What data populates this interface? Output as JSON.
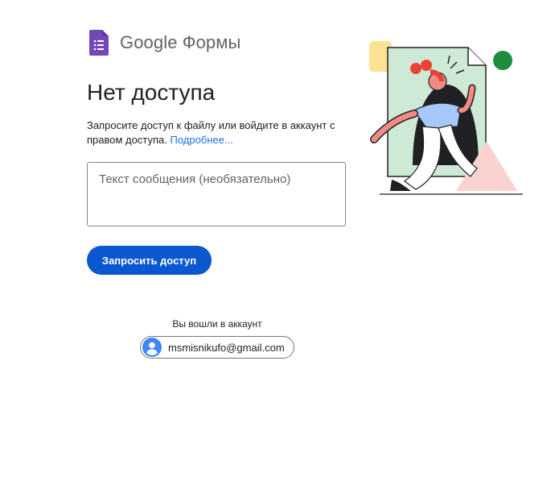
{
  "brand": {
    "google": "Google",
    "product": "Формы",
    "color": "#7248b9"
  },
  "heading": "Нет доступа",
  "description": {
    "text": "Запросите доступ к файлу или войдите в аккаунт с правом доступа.",
    "link": "Подробнее..."
  },
  "message": {
    "placeholder": "Текст сообщения (необязательно)",
    "value": ""
  },
  "request_button": {
    "label": "Запросить доступ",
    "color": "#0b57d0"
  },
  "account": {
    "signed_in_label": "Вы вошли в аккаунт",
    "email": "msmisnikufo@gmail.com",
    "avatar_color": "#4285f4"
  },
  "illustration": {
    "icon": "person-running-through-document-illustration"
  }
}
